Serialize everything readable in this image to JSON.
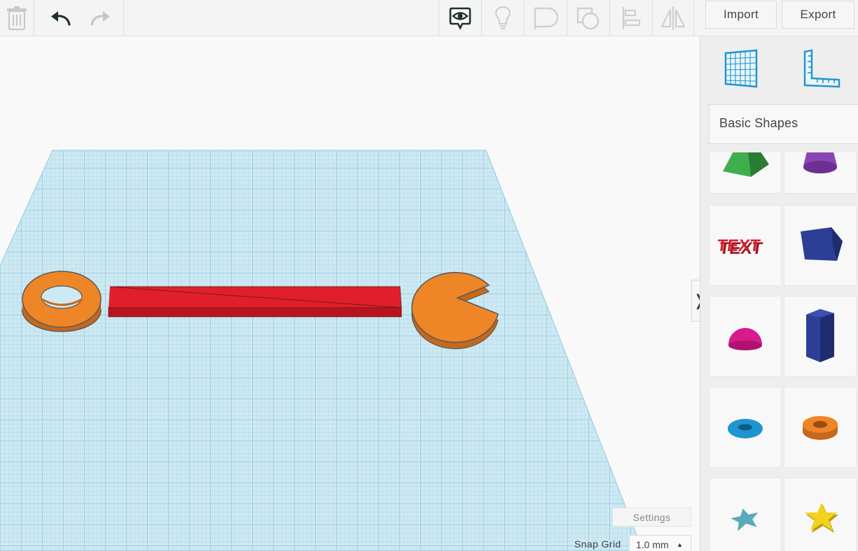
{
  "toolbar": {
    "icons": [
      "trash-icon",
      "undo-icon",
      "redo-icon",
      "notes-visibility-icon",
      "light-bulb-icon",
      "group-icon",
      "ungroup-icon",
      "align-icon",
      "mirror-icon"
    ],
    "import_label": "Import",
    "export_label": "Export"
  },
  "workplane": {
    "grid_color": "#bfe3f0",
    "objects": [
      {
        "name": "washer",
        "color": "#ee8527"
      },
      {
        "name": "bar",
        "color": "#e01f2b"
      },
      {
        "name": "wrench-head",
        "color": "#ee8527"
      }
    ]
  },
  "panel": {
    "top_icons": [
      "workplane-icon",
      "ruler-icon"
    ],
    "category": "Basic Shapes",
    "shapes": [
      {
        "name": "pyramid",
        "color": "#2e9b3d"
      },
      {
        "name": "cone",
        "color": "#7b3aa6"
      },
      {
        "name": "text",
        "color": "#d5222e",
        "label": "TEXT"
      },
      {
        "name": "polygon",
        "color": "#2a3c8f"
      },
      {
        "name": "half-sphere",
        "color": "#d81a8c"
      },
      {
        "name": "hexagonal-prism",
        "color": "#2a3c8f"
      },
      {
        "name": "torus",
        "color": "#1d95cf"
      },
      {
        "name": "tube",
        "color": "#ee8527"
      },
      {
        "name": "star",
        "color": "#5aa9bb"
      },
      {
        "name": "star-yellow",
        "color": "#f2d21c"
      }
    ]
  },
  "collapse_label": "❭",
  "settings_label": "Settings",
  "snap_grid": {
    "label": "Snap Grid",
    "value": "1.0 mm",
    "caret": "▲"
  }
}
